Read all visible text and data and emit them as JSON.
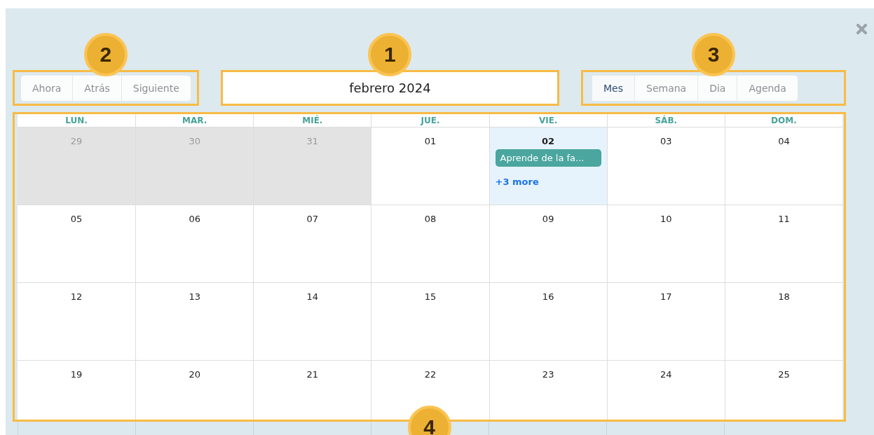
{
  "navigation": [
    {
      "label": "Ahora"
    },
    {
      "label": "Atrás"
    },
    {
      "label": "Siguiente"
    }
  ],
  "title": "febrero 2024",
  "views": [
    {
      "label": "Mes",
      "selected": true
    },
    {
      "label": "Semana",
      "selected": false
    },
    {
      "label": "Dia",
      "selected": false
    },
    {
      "label": "Agenda",
      "selected": false
    }
  ],
  "weekdays": [
    "LUN.",
    "MAR.",
    "MIÉ.",
    "JUE.",
    "VIE.",
    "SÁB.",
    "DOM."
  ],
  "weeks": [
    {
      "days": [
        {
          "label": "29",
          "outside": true,
          "today": false
        },
        {
          "label": "30",
          "outside": true,
          "today": false
        },
        {
          "label": "31",
          "outside": true,
          "today": false
        },
        {
          "label": "01",
          "outside": false,
          "today": false
        },
        {
          "label": "02",
          "outside": false,
          "today": true,
          "events": [
            {
              "title": "Aprende de la fa..."
            }
          ],
          "more": "+3 more"
        },
        {
          "label": "03",
          "outside": false,
          "today": false
        },
        {
          "label": "04",
          "outside": false,
          "today": false
        }
      ]
    },
    {
      "days": [
        {
          "label": "05",
          "outside": false,
          "today": false
        },
        {
          "label": "06",
          "outside": false,
          "today": false
        },
        {
          "label": "07",
          "outside": false,
          "today": false
        },
        {
          "label": "08",
          "outside": false,
          "today": false
        },
        {
          "label": "09",
          "outside": false,
          "today": false
        },
        {
          "label": "10",
          "outside": false,
          "today": false
        },
        {
          "label": "11",
          "outside": false,
          "today": false
        }
      ]
    },
    {
      "days": [
        {
          "label": "12",
          "outside": false,
          "today": false
        },
        {
          "label": "13",
          "outside": false,
          "today": false
        },
        {
          "label": "14",
          "outside": false,
          "today": false
        },
        {
          "label": "15",
          "outside": false,
          "today": false
        },
        {
          "label": "16",
          "outside": false,
          "today": false
        },
        {
          "label": "17",
          "outside": false,
          "today": false
        },
        {
          "label": "18",
          "outside": false,
          "today": false
        }
      ]
    },
    {
      "days": [
        {
          "label": "19",
          "outside": false,
          "today": false
        },
        {
          "label": "20",
          "outside": false,
          "today": false
        },
        {
          "label": "21",
          "outside": false,
          "today": false
        },
        {
          "label": "22",
          "outside": false,
          "today": false
        },
        {
          "label": "23",
          "outside": false,
          "today": false
        },
        {
          "label": "24",
          "outside": false,
          "today": false
        },
        {
          "label": "25",
          "outside": false,
          "today": false
        }
      ]
    }
  ],
  "annotations": {
    "title": "1",
    "navigation": "2",
    "views": "3",
    "calendar": "4"
  }
}
